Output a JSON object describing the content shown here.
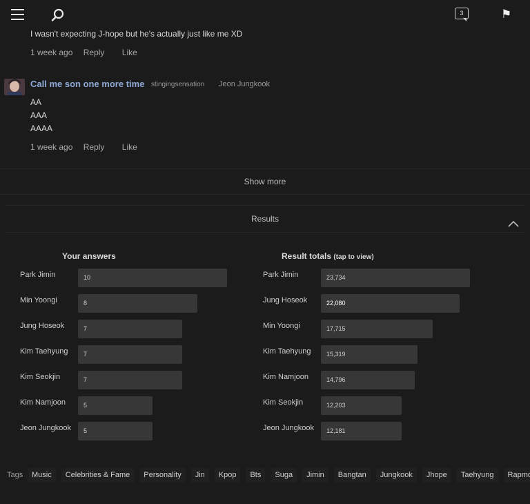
{
  "header": {
    "notification_count": "3"
  },
  "previous_comment": {
    "text": "I wasn't expecting J-hope but he's actually just like me XD",
    "time": "1 week ago",
    "reply_label": "Reply",
    "like_label": "Like"
  },
  "comment": {
    "author": "Call me son one more time",
    "username": "stingingsensation",
    "tagged": "Jeon Jungkook",
    "lines": [
      "AA",
      "AAA",
      "AAAA"
    ],
    "time": "1 week ago",
    "reply_label": "Reply",
    "like_label": "Like"
  },
  "show_more_label": "Show more",
  "results_label": "Results",
  "your_answers": {
    "title": "Your answers",
    "rows": [
      {
        "label": "Park Jimin",
        "value": "10",
        "fraction": 1.0
      },
      {
        "label": "Min Yoongi",
        "value": "8",
        "fraction": 0.8
      },
      {
        "label": "Jung Hoseok",
        "value": "7",
        "fraction": 0.7
      },
      {
        "label": "Kim Taehyung",
        "value": "7",
        "fraction": 0.7
      },
      {
        "label": "Kim Seokjin",
        "value": "7",
        "fraction": 0.7
      },
      {
        "label": "Kim Namjoon",
        "value": "5",
        "fraction": 0.5
      },
      {
        "label": "Jeon Jungkook",
        "value": "5",
        "fraction": 0.5
      }
    ]
  },
  "result_totals": {
    "title": "Result totals",
    "subtitle": "(tap to view)",
    "rows": [
      {
        "label": "Park Jimin",
        "value": "23,734",
        "fraction": 1.0
      },
      {
        "label": "Jung Hoseok",
        "value": "22,080",
        "fraction": 0.93
      },
      {
        "label": "Min Yoongi",
        "value": "17,715",
        "fraction": 0.75
      },
      {
        "label": "Kim Taehyung",
        "value": "15,319",
        "fraction": 0.65
      },
      {
        "label": "Kim Namjoon",
        "value": "14,796",
        "fraction": 0.63
      },
      {
        "label": "Kim Seokjin",
        "value": "12,203",
        "fraction": 0.54
      },
      {
        "label": "Jeon Jungkook",
        "value": "12,181",
        "fraction": 0.54
      }
    ]
  },
  "tags_label": "Tags",
  "tags": [
    "Music",
    "Celebrities & Fame",
    "Personality",
    "Jin",
    "Kpop",
    "Bts",
    "Suga",
    "Jimin",
    "Bangtan",
    "Jungkook",
    "Jhope",
    "Taehyung",
    "Rapmon"
  ]
}
